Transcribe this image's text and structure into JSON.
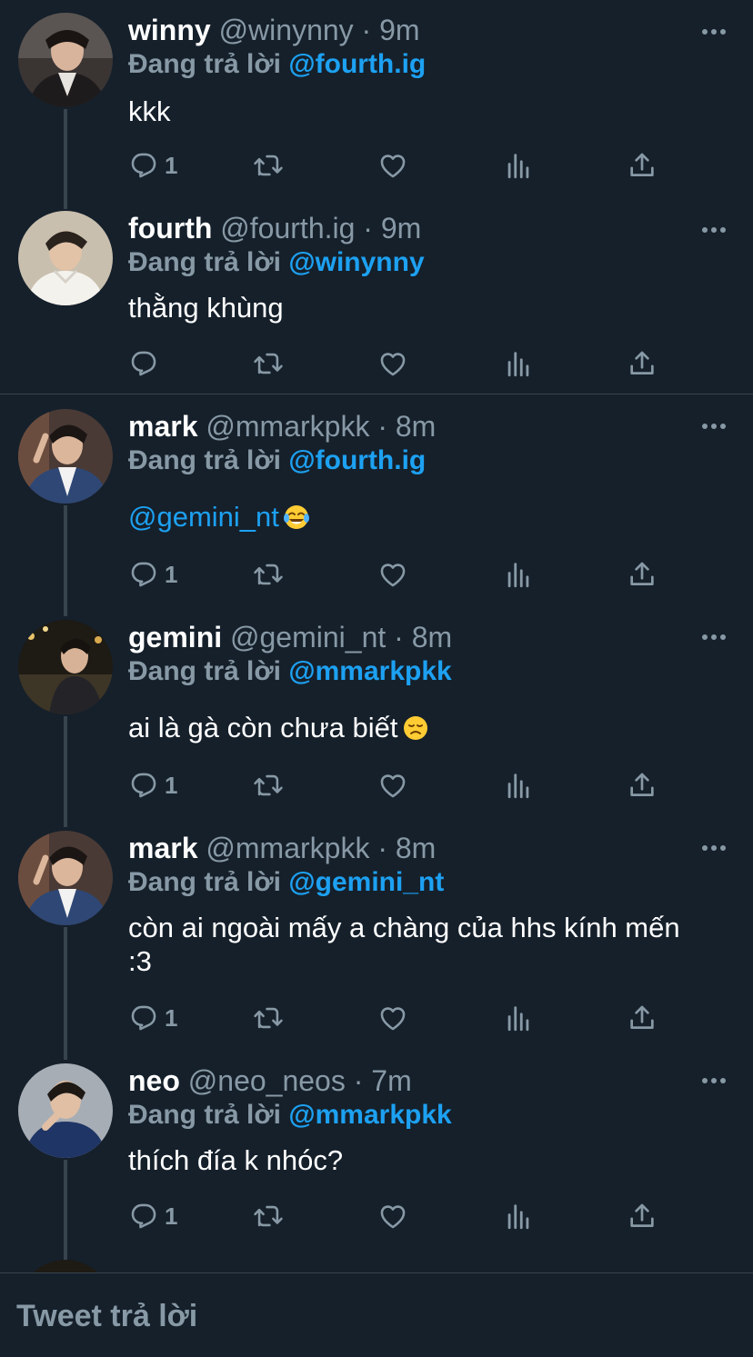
{
  "thread": {
    "tweets": [
      {
        "name": "winny",
        "handle": "@winynny",
        "time": "9m",
        "replying_label": "Đang trả lời",
        "replying_to": "@fourth.ig",
        "text": "kkk",
        "reply_count": "1",
        "avatar": "winny-avatar"
      },
      {
        "name": "fourth",
        "handle": "@fourth.ig",
        "time": "9m",
        "replying_label": "Đang trả lời",
        "replying_to": "@winynny",
        "text": "thằng khùng",
        "reply_count": "",
        "avatar": "fourth-avatar"
      },
      {
        "name": "mark",
        "handle": "@mmarkpkk",
        "time": "8m",
        "replying_label": "Đang trả lời",
        "replying_to": "@fourth.ig",
        "text_mention": "@gemini_nt",
        "emoji": "face-with-tears-of-joy",
        "reply_count": "1",
        "avatar": "mark-avatar"
      },
      {
        "name": "gemini",
        "handle": "@gemini_nt",
        "time": "8m",
        "replying_label": "Đang trả lời",
        "replying_to": "@mmarkpkk",
        "text": "ai là gà còn chưa biết",
        "emoji": "disappointed-face",
        "reply_count": "1",
        "avatar": "gemini-avatar"
      },
      {
        "name": "mark",
        "handle": "@mmarkpkk",
        "time": "8m",
        "replying_label": "Đang trả lời",
        "replying_to": "@gemini_nt",
        "text": "còn ai ngoài mấy a chàng của hhs kính mến :3",
        "reply_count": "1",
        "avatar": "mark-avatar"
      },
      {
        "name": "neo",
        "handle": "@neo_neos",
        "time": "7m",
        "replying_label": "Đang trả lời",
        "replying_to": "@mmarkpkk",
        "text": "thích đía k nhóc?",
        "reply_count": "1",
        "avatar": "neo-avatar"
      }
    ],
    "separator": "·",
    "action_icons": [
      "reply-icon",
      "retweet-icon",
      "like-icon",
      "analytics-icon",
      "share-icon"
    ],
    "more_icon": "more-options-icon"
  },
  "composer": {
    "placeholder": "Tweet trả lời"
  },
  "colors": {
    "background": "#15202b",
    "accent": "#1da1f2",
    "secondary_text": "#8899a6",
    "border": "#38444d"
  }
}
